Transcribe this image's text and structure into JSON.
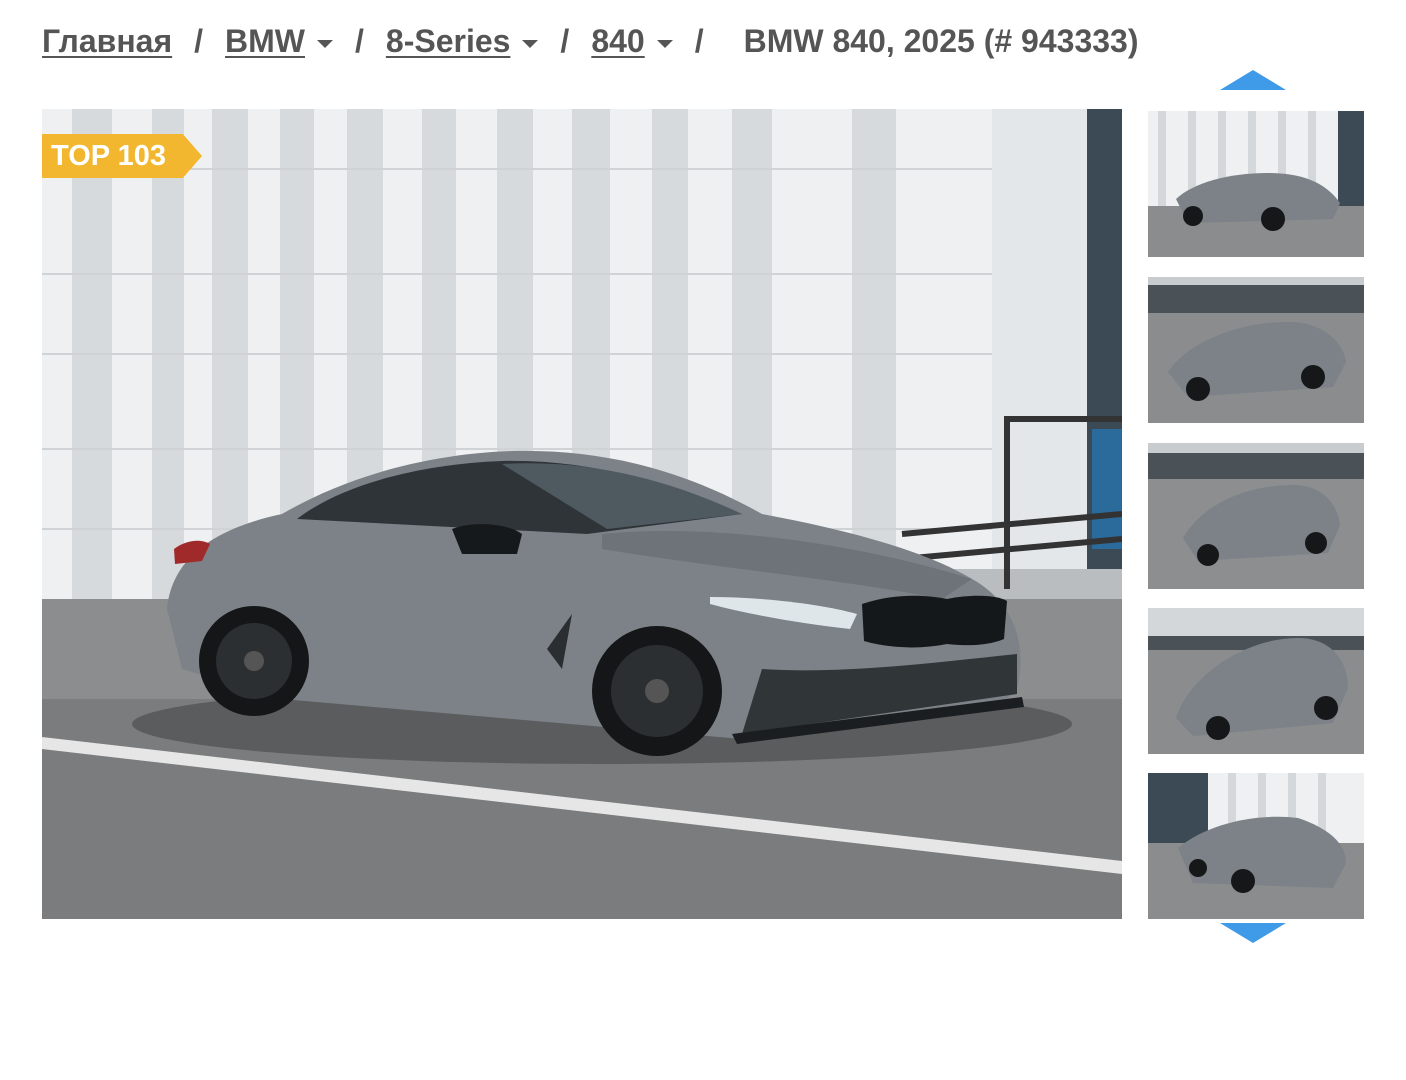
{
  "breadcrumb": {
    "home": "Главная",
    "brand": "BMW",
    "series": "8-Series",
    "model": "840",
    "separator": "/",
    "current": "BMW 840, 2025 (# 943333)"
  },
  "listing": {
    "badge": "TOP 103",
    "main_photo_alt": "BMW 840, 2025",
    "thumbnails_count": 5
  },
  "colors": {
    "badge": "#f2b72e",
    "arrow": "#3f9ae8",
    "text": "#555555",
    "car_paint": "#7c8288"
  },
  "icons": {
    "dropdown": "chevron-down-icon",
    "scroll_up": "triangle-up-icon",
    "scroll_down": "triangle-down-icon"
  }
}
